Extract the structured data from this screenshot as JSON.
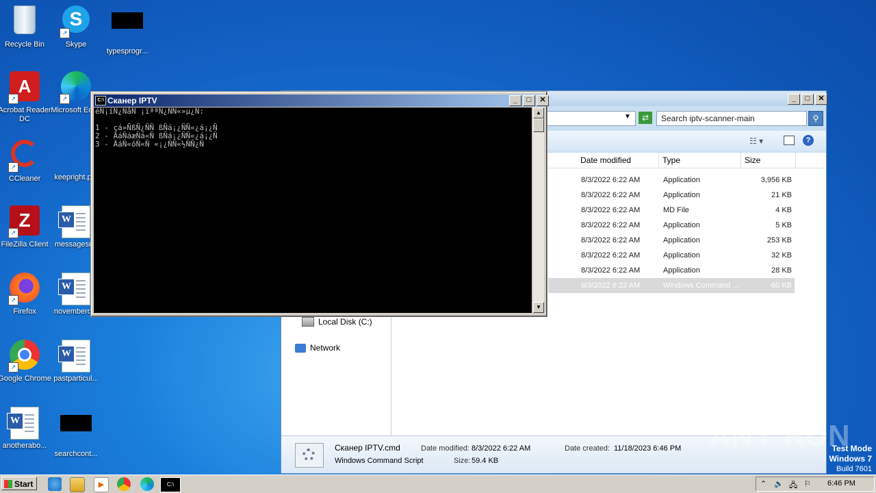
{
  "desktop": {
    "icons": [
      {
        "label": "Recycle Bin"
      },
      {
        "label": "Skype"
      },
      {
        "label": "typesprogr..."
      },
      {
        "label": "Acrobat Reader DC"
      },
      {
        "label": "Microsoft Edge"
      },
      {
        "label": "CCleaner"
      },
      {
        "label": "keepright.p..."
      },
      {
        "label": "FileZilla Client"
      },
      {
        "label": "messagesr..."
      },
      {
        "label": "Firefox"
      },
      {
        "label": "novemberd..."
      },
      {
        "label": "Google Chrome"
      },
      {
        "label": "pastparticul..."
      },
      {
        "label": "anotherabo..."
      },
      {
        "label": "searchcont..."
      }
    ]
  },
  "cmd": {
    "title": "Сканер IPTV",
    "lines": [
      "éÑ¡íÑ¿ÑâÑ ¡ïªªÑ¿ÑÑ«»µ¿Ñ:",
      "",
      "1 - çá»ÑßÑ¿ÑÑ ßÑá¡¿ÑÑ«¿á¡¿Ñ",
      "2 - ÄáÑáæÑá«Ñ ßÑá¡¿ÑÑ«¿á¡¿Ñ",
      "3 - ÄáÑ«óÑ«Ñ «¡¿ÑÑ«½ÑÑ¿Ñ"
    ]
  },
  "explorer": {
    "search_placeholder": "Search iptv-scanner-main",
    "columns": {
      "date": "Date modified",
      "type": "Type",
      "size": "Size"
    },
    "rows": [
      {
        "date": "8/3/2022 6:22 AM",
        "type": "Application",
        "size": "3,956 KB"
      },
      {
        "date": "8/3/2022 6:22 AM",
        "type": "Application",
        "size": "21 KB"
      },
      {
        "date": "8/3/2022 6:22 AM",
        "type": "MD File",
        "size": "4 KB"
      },
      {
        "date": "8/3/2022 6:22 AM",
        "type": "Application",
        "size": "5 KB"
      },
      {
        "date": "8/3/2022 6:22 AM",
        "type": "Application",
        "size": "253 KB"
      },
      {
        "date": "8/3/2022 6:22 AM",
        "type": "Application",
        "size": "32 KB"
      },
      {
        "date": "8/3/2022 6:22 AM",
        "type": "Application",
        "size": "28 KB"
      },
      {
        "date": "8/3/2022 6:22 AM",
        "type": "Windows Command ...",
        "size": "60 KB"
      }
    ],
    "nav": {
      "local_disk": "Local Disk (C:)",
      "network": "Network"
    },
    "details": {
      "name": "Сканер IPTV.cmd",
      "kind": "Windows Command Script",
      "modified_label": "Date modified:",
      "modified": "8/3/2022 6:22 AM",
      "size_label": "Size:",
      "size": "59.4 KB",
      "created_label": "Date created:",
      "created": "11/18/2023 6:46 PM"
    }
  },
  "taskbar": {
    "start": "Start",
    "clock": "6:46 PM"
  },
  "watermark": "ANY RUN",
  "windows_info": {
    "line1": "Test Mode",
    "line2": "Windows 7",
    "line3": "Build 7601"
  }
}
